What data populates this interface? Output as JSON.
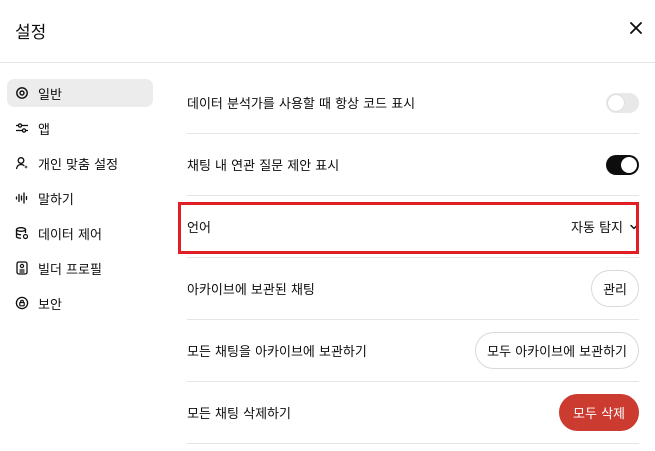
{
  "header": {
    "title": "설정",
    "close_icon": "close-icon"
  },
  "sidebar": {
    "items": [
      {
        "label": "일반",
        "icon": "gear-icon",
        "active": true
      },
      {
        "label": "앱",
        "icon": "apps-icon",
        "active": false
      },
      {
        "label": "개인 맞춤 설정",
        "icon": "personalization-icon",
        "active": false
      },
      {
        "label": "말하기",
        "icon": "voice-icon",
        "active": false
      },
      {
        "label": "데이터 제어",
        "icon": "data-icon",
        "active": false
      },
      {
        "label": "빌더 프로필",
        "icon": "profile-icon",
        "active": false
      },
      {
        "label": "보안",
        "icon": "shield-icon",
        "active": false
      }
    ]
  },
  "settings": {
    "code_toggle": {
      "label": "데이터 분석가를 사용할 때 항상 코드 표시",
      "on": false
    },
    "suggestions_toggle": {
      "label": "채팅 내 연관 질문 제안 표시",
      "on": true
    },
    "language": {
      "label": "언어",
      "value": "자동 탐지"
    },
    "archived": {
      "label": "아카이브에 보관된 채팅",
      "button": "관리"
    },
    "archive_all": {
      "label": "모든 채팅을 아카이브에 보관하기",
      "button": "모두 아카이브에 보관하기"
    },
    "delete_all": {
      "label": "모든 채팅 삭제하기",
      "button": "모두 삭제"
    }
  },
  "colors": {
    "highlight": "#e01e24",
    "danger": "#cc3b2f",
    "toggle_on": "#0d0d0d"
  }
}
